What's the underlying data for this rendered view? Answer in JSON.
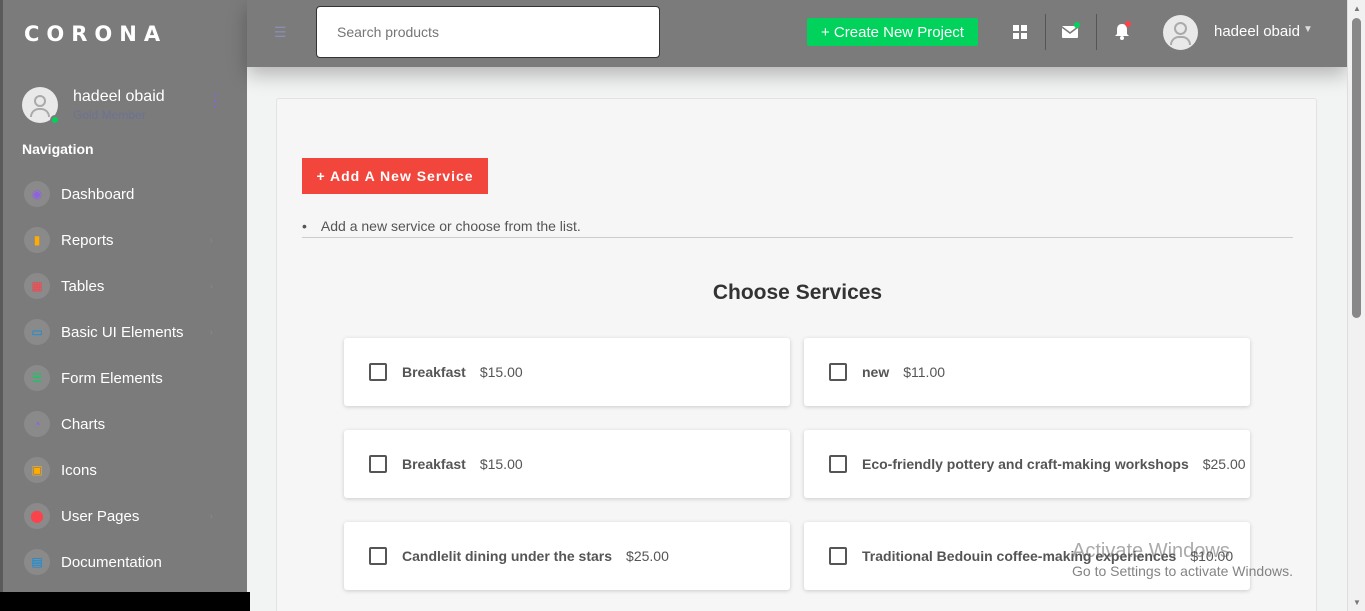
{
  "sidebar": {
    "brand": "CORONA",
    "profile": {
      "name": "hadeel obaid",
      "role": "Gold Member"
    },
    "nav_heading": "Navigation",
    "items": [
      {
        "label": "Dashboard",
        "icon": "dashboard-icon",
        "color": "#8f5fe8",
        "glyph": "◉",
        "has_arrow": false
      },
      {
        "label": "Reports",
        "icon": "chart-bar-icon",
        "color": "#ffab00",
        "glyph": "▮",
        "has_arrow": true
      },
      {
        "label": "Tables",
        "icon": "table-icon",
        "color": "#fc424a",
        "glyph": "▦",
        "has_arrow": true
      },
      {
        "label": "Basic UI Elements",
        "icon": "laptop-icon",
        "color": "#0090e7",
        "glyph": "▭",
        "has_arrow": true
      },
      {
        "label": "Form Elements",
        "icon": "playlist-icon",
        "color": "#00d25b",
        "glyph": "☰",
        "has_arrow": false
      },
      {
        "label": "Charts",
        "icon": "pie-chart-icon",
        "color": "#8f5fe8",
        "glyph": "◔",
        "has_arrow": false
      },
      {
        "label": "Icons",
        "icon": "contacts-icon",
        "color": "#ffab00",
        "glyph": "▣",
        "has_arrow": false
      },
      {
        "label": "User Pages",
        "icon": "security-icon",
        "color": "#fc424a",
        "glyph": "⬤",
        "has_arrow": true
      },
      {
        "label": "Documentation",
        "icon": "file-document-icon",
        "color": "#0090e7",
        "glyph": "▤",
        "has_arrow": false
      }
    ]
  },
  "topbar": {
    "search_placeholder": "Search products",
    "create_label": "+ Create New Project",
    "username": "hadeel obaid"
  },
  "main": {
    "add_service_label": "+ Add A New Service",
    "hint": "Add a new service or choose from the list.",
    "section_title": "Choose Services",
    "services": [
      {
        "name": "Breakfast",
        "price": "$15.00"
      },
      {
        "name": "new",
        "price": "$11.00"
      },
      {
        "name": "Breakfast",
        "price": "$15.00"
      },
      {
        "name": "Eco-friendly pottery and craft-making workshops",
        "price": "$25.00"
      },
      {
        "name": "Candlelit dining under the stars",
        "price": "$25.00"
      },
      {
        "name": "Traditional Bedouin coffee-making experiences",
        "price": "$10.00"
      }
    ]
  },
  "watermark": {
    "line1": "Activate Windows",
    "line2": "Go to Settings to activate Windows."
  }
}
